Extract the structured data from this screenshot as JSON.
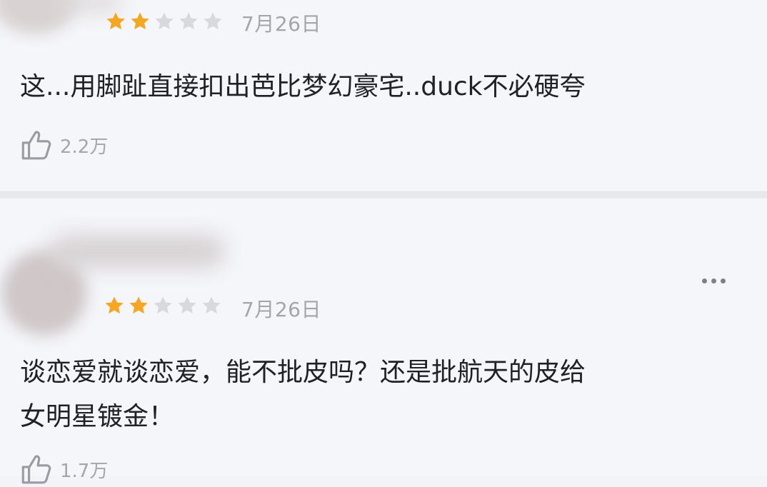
{
  "colors": {
    "star_filled": "#f5a623",
    "star_empty": "#d7d9de",
    "text_primary": "#202124",
    "text_secondary": "#a3a5ad"
  },
  "reviews": [
    {
      "rating": 2,
      "rating_max": 5,
      "date": "7月26日",
      "text_lines": [
        "这...用脚趾直接扣出芭比梦幻豪宅..duck不必硬夸"
      ],
      "likes": "2.2万",
      "like_icon": "thumbs-up-icon"
    },
    {
      "rating": 2,
      "rating_max": 5,
      "date": "7月26日",
      "text_lines": [
        "谈恋爱就谈恋爱，能不批皮吗？还是批航天的皮给",
        "女明星镀金！"
      ],
      "likes": "1.7万",
      "like_icon": "thumbs-up-icon",
      "more_icon": "more-options-icon"
    }
  ]
}
